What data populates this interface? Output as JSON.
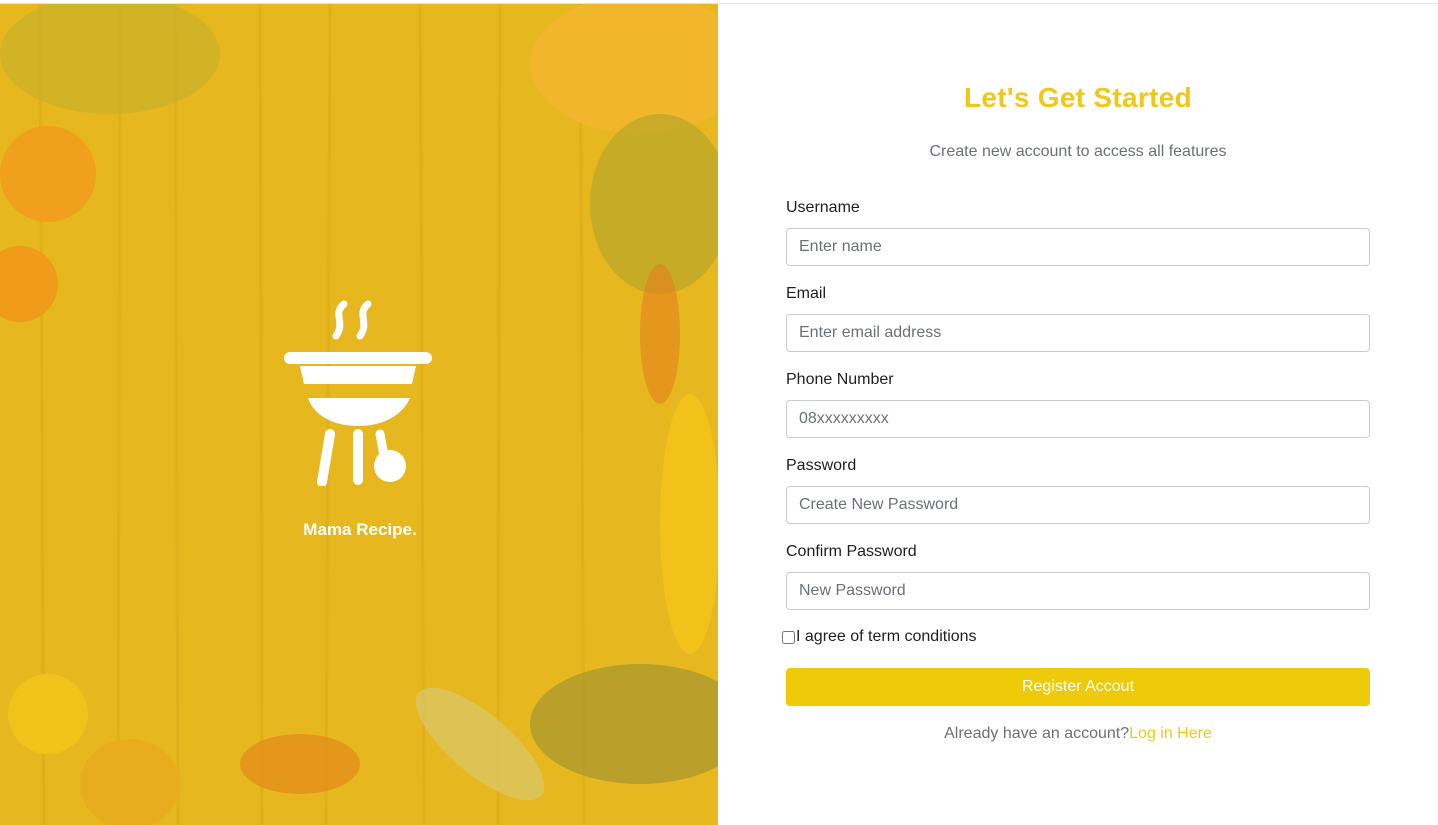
{
  "brand": {
    "name": "Mama Recipe."
  },
  "form": {
    "title": "Let's Get Started",
    "subtitle": "Create new account to access all features",
    "fields": [
      {
        "label": "Username",
        "placeholder": "Enter name"
      },
      {
        "label": "Email",
        "placeholder": "Enter email address"
      },
      {
        "label": "Phone Number",
        "placeholder": "08xxxxxxxxx"
      },
      {
        "label": "Password",
        "placeholder": "Create New Password"
      },
      {
        "label": "Confirm Password",
        "placeholder": "New Password"
      }
    ],
    "agree_label": "I agree of term conditions",
    "agree_checked": false,
    "register_label": "Register Accout",
    "login_prompt": "Already have an account?",
    "login_link": "Log in Here"
  },
  "colors": {
    "accent": "#efc81a",
    "button": "#efca08",
    "hero_overlay": "#e8b820",
    "muted_text": "#6c7079"
  },
  "icons": {
    "logo": "grill-icon"
  }
}
